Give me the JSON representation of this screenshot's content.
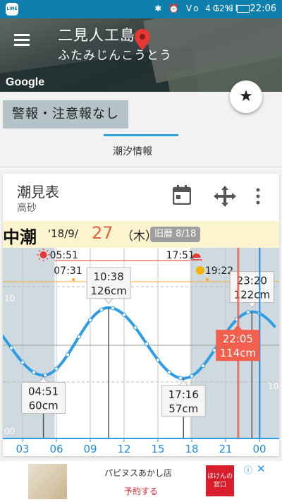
{
  "status_bar": {
    "app_badge": "LINE",
    "icons": "✱ ⏰ Vo 4G ıll",
    "battery": "12%",
    "time": "22:06"
  },
  "header": {
    "place_name": "二見人工島",
    "place_reading": "ふたみじんこうとう",
    "map_attribution": "Google"
  },
  "warning": "警報・注意報なし",
  "tab": "潮汐情報",
  "card": {
    "title": "潮見表",
    "subtitle": "高砂",
    "tide_type": "中潮",
    "date_prefix": "'18/9/",
    "date_day": "27",
    "weekday": "（木）",
    "lunar": "旧暦 8/18"
  },
  "chart_data": {
    "type": "line",
    "sunrise": "05:51",
    "sunset": "17:51",
    "moonset": "07:31",
    "moonrise": "19:22",
    "current_time": "22:05",
    "current_level_cm": 114,
    "current_label": "114cm",
    "extremes": [
      {
        "type": "low",
        "time": "04:51",
        "level_cm": 60,
        "level_label": "60cm"
      },
      {
        "type": "high",
        "time": "10:38",
        "level_cm": 126,
        "level_label": "126cm"
      },
      {
        "type": "low",
        "time": "17:16",
        "level_cm": 57,
        "level_label": "57cm"
      },
      {
        "type": "high",
        "time": "23:20",
        "level_cm": 122,
        "level_label": "122cm"
      }
    ],
    "x_ticks": [
      "03",
      "06",
      "09",
      "12",
      "15",
      "18",
      "21",
      "00"
    ],
    "y_ticks_left": [
      "00",
      "10"
    ],
    "y_ticks_right": [
      "10",
      "0"
    ],
    "colors": {
      "curve": "#2e9de3",
      "now": "#f25f4d",
      "sun": "#f5a623",
      "moon": "#f4b400",
      "highlight": "#1e88e5"
    }
  },
  "ad": {
    "title": "パピヌスあかし店",
    "cta": "予約する",
    "logo": "ほけんの 窓口",
    "info": "ⓘ",
    "close": "✕"
  }
}
